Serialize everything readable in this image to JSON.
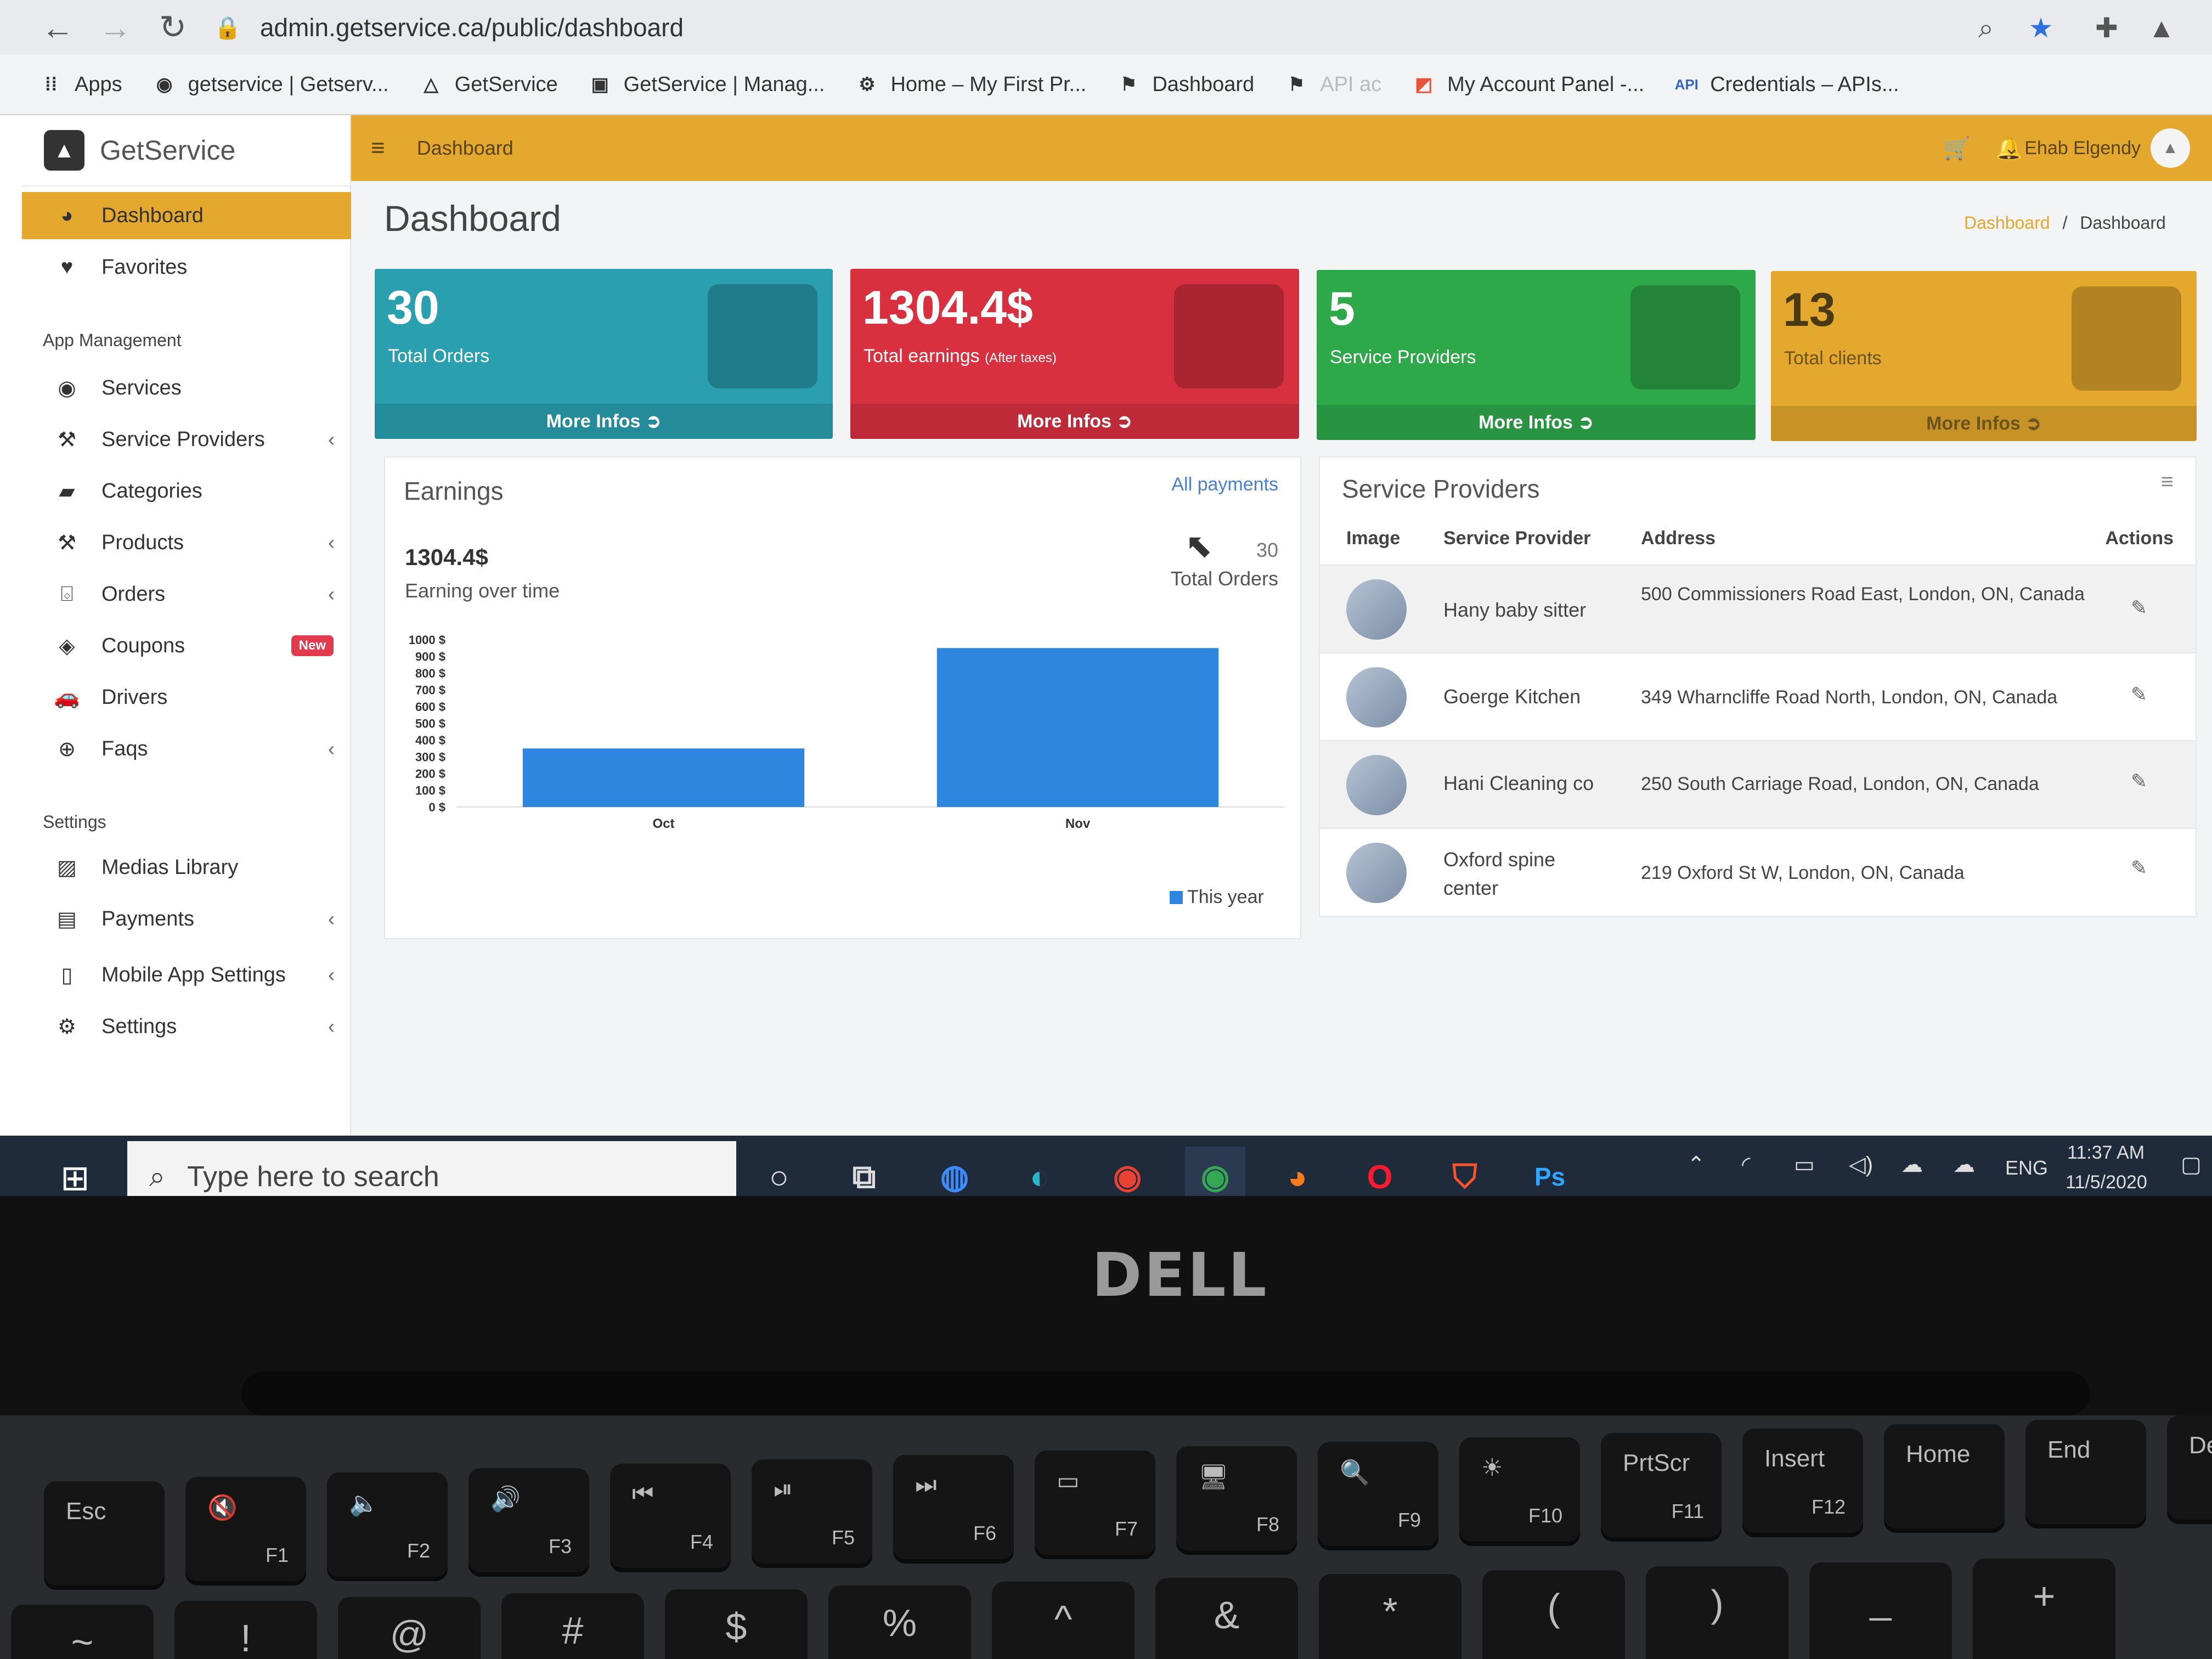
{
  "browser": {
    "url": "admin.getservice.ca/public/dashboard",
    "bookmarks": [
      {
        "icon": "apps-grid-icon",
        "label": "Apps"
      },
      {
        "icon": "globe-icon",
        "label": "getservice | Getserv..."
      },
      {
        "icon": "triangle-logo-icon",
        "label": "GetService"
      },
      {
        "icon": "getservice-logo-icon",
        "label": "GetService | Manag..."
      },
      {
        "icon": "wordpress-icon",
        "label": "Home – My First Pr..."
      },
      {
        "icon": "flag-icon",
        "label": "Dashboard"
      },
      {
        "icon": "flag-icon",
        "label": "API ac"
      },
      {
        "icon": "account-icon",
        "label": "My Account Panel -..."
      },
      {
        "icon": "api-icon",
        "label": "Credentials – APIs..."
      }
    ]
  },
  "brand": {
    "name": "GetService"
  },
  "sidebar": {
    "items": [
      {
        "label": "Dashboard",
        "icon": "palette-icon",
        "active": true
      },
      {
        "label": "Favorites",
        "icon": "heart-icon"
      }
    ],
    "section_app": "App Management",
    "app_items": [
      {
        "label": "Services",
        "icon": "globe-icon"
      },
      {
        "label": "Service Providers",
        "icon": "wrench-icon",
        "chevron": true
      },
      {
        "label": "Categories",
        "icon": "folder-icon"
      },
      {
        "label": "Products",
        "icon": "wrench-icon",
        "chevron": true
      },
      {
        "label": "Orders",
        "icon": "basket-icon",
        "chevron": true
      },
      {
        "label": "Coupons",
        "icon": "tag-icon",
        "badge": "New"
      },
      {
        "label": "Drivers",
        "icon": "car-icon"
      },
      {
        "label": "Faqs",
        "icon": "lifebuoy-icon",
        "chevron": true
      }
    ],
    "section_settings": "Settings",
    "settings_items": [
      {
        "label": "Medias Library",
        "icon": "image-icon"
      },
      {
        "label": "Payments",
        "icon": "credit-card-icon",
        "chevron": true
      },
      {
        "label": "Mobile App Settings",
        "icon": "mobile-icon",
        "chevron": true
      },
      {
        "label": "Settings",
        "icon": "cogs-icon",
        "chevron": true
      }
    ]
  },
  "topbar": {
    "breadcrumb": "Dashboard",
    "user": "Ehab Elgendy"
  },
  "page": {
    "title": "Dashboard",
    "breadcrumb_link": "Dashboard",
    "breadcrumb_sep": "/",
    "breadcrumb_current": "Dashboard"
  },
  "stats": [
    {
      "value": "30",
      "label": "Total Orders",
      "sub": "",
      "more": "More Infos",
      "color": "#2a9fb0"
    },
    {
      "value": "1304.4$",
      "label": "Total earnings",
      "sub": "(After taxes)",
      "more": "More Infos",
      "color": "#d9303f"
    },
    {
      "value": "5",
      "label": "Service Providers",
      "sub": "",
      "more": "More Infos",
      "color": "#2ea94a"
    },
    {
      "value": "13",
      "label": "Total clients",
      "sub": "",
      "more": "More Infos",
      "color": "#e3a82d"
    }
  ],
  "earnings": {
    "title": "Earnings",
    "link": "All payments",
    "amount": "1304.4$",
    "caption": "Earning over time",
    "orders_count": "30",
    "orders_label": "Total Orders"
  },
  "chart_data": {
    "type": "bar",
    "categories": [
      "Oct",
      "Nov"
    ],
    "series": [
      {
        "name": "This year",
        "values": [
          350,
          950
        ],
        "color": "#2e86de"
      }
    ],
    "ylim": [
      0,
      1000
    ],
    "yticks": [
      "0 $",
      "100 $",
      "200 $",
      "300 $",
      "400 $",
      "500 $",
      "600 $",
      "700 $",
      "800 $",
      "900 $",
      "1000 $"
    ],
    "legend": "bottom-right",
    "grid": false
  },
  "providers": {
    "title": "Service Providers",
    "columns": [
      "Image",
      "Service Provider",
      "Address",
      "Actions"
    ],
    "rows": [
      {
        "name": "Hany baby sitter",
        "address": "500 Commissioners Road East, London, ON, Canada"
      },
      {
        "name": "Goerge Kitchen",
        "address": "349 Wharncliffe Road North, London, ON, Canada"
      },
      {
        "name": "Hani Cleaning co",
        "address": "250 South Carriage Road, London, ON, Canada"
      },
      {
        "name": "Oxford spine center",
        "address": "219 Oxford St W, London, ON, Canada"
      }
    ]
  },
  "taskbar": {
    "search_placeholder": "Type here to search",
    "lang": "ENG",
    "time": "11:37 AM",
    "date": "11/5/2020",
    "apps": [
      "cortana-icon",
      "task-view-icon",
      "app-icon",
      "edge-icon",
      "chrome-icon",
      "chrome-icon",
      "firefox-icon",
      "opera-icon",
      "brave-icon",
      "photoshop-icon"
    ]
  },
  "laptop": {
    "brand": "DELL"
  },
  "keyboard": {
    "fn_row": [
      {
        "top": "Esc",
        "bottom": ""
      },
      {
        "top": "🔇",
        "bottom": "F1"
      },
      {
        "top": "🔈",
        "bottom": "F2"
      },
      {
        "top": "🔊",
        "bottom": "F3"
      },
      {
        "top": "⏮",
        "bottom": "F4"
      },
      {
        "top": "⏯",
        "bottom": "F5"
      },
      {
        "top": "⏭",
        "bottom": "F6"
      },
      {
        "top": "▭",
        "bottom": "F7"
      },
      {
        "top": "🖥",
        "bottom": "F8"
      },
      {
        "top": "🔍",
        "bottom": "F9"
      },
      {
        "top": "☀",
        "bottom": "F10"
      },
      {
        "top": "PrtScr",
        "bottom": "F11"
      },
      {
        "top": "Insert",
        "bottom": "F12"
      },
      {
        "top": "Home",
        "bottom": ""
      },
      {
        "top": "End",
        "bottom": ""
      },
      {
        "top": "Del",
        "bottom": ""
      }
    ],
    "num_row": [
      "~",
      "!",
      "@",
      "#",
      "$",
      "%",
      "^",
      "&",
      "*",
      "(",
      ")",
      "_",
      "+"
    ]
  }
}
